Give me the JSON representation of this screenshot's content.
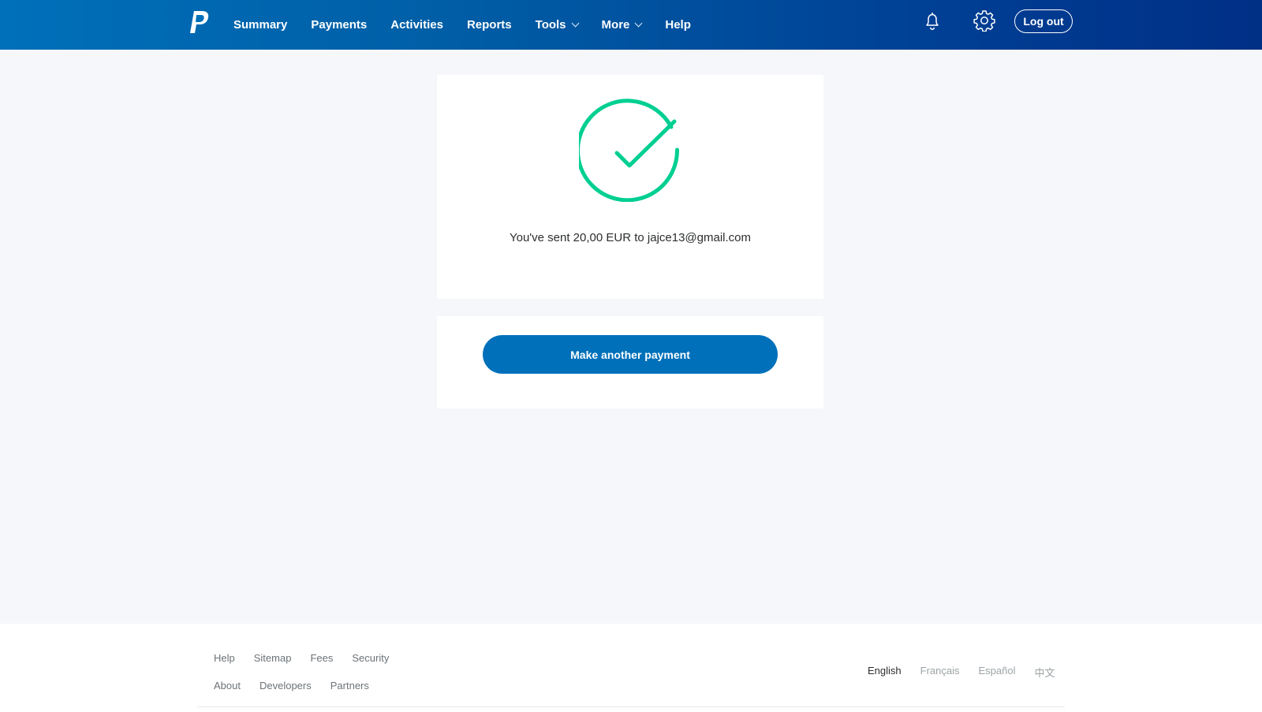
{
  "header": {
    "logo_icon": "paypal-logo",
    "nav": [
      {
        "label": "Summary",
        "dropdown": false
      },
      {
        "label": "Payments",
        "dropdown": false
      },
      {
        "label": "Activities",
        "dropdown": false
      },
      {
        "label": "Reports",
        "dropdown": false
      },
      {
        "label": "Tools",
        "dropdown": true
      },
      {
        "label": "More",
        "dropdown": true
      },
      {
        "label": "Help",
        "dropdown": false
      }
    ],
    "notifications_icon": "bell-icon",
    "settings_icon": "gear-icon",
    "logout_label": "Log out"
  },
  "confirmation": {
    "status_icon": "check-circle-icon",
    "message": "You've sent 20,00 EUR to jajce13@gmail.com"
  },
  "actions": {
    "primary_label": "Make another payment"
  },
  "footer": {
    "links_row1": [
      "Help",
      "Sitemap",
      "Fees",
      "Security"
    ],
    "links_row2": [
      "About",
      "Developers",
      "Partners"
    ],
    "languages": [
      "English",
      "Français",
      "Español",
      "中文"
    ],
    "active_language": "English"
  },
  "colors": {
    "brand_blue": "#0070ba",
    "header_gradient_end": "#002f86",
    "success_green": "#00cf92",
    "page_background": "#f5f7fa"
  }
}
